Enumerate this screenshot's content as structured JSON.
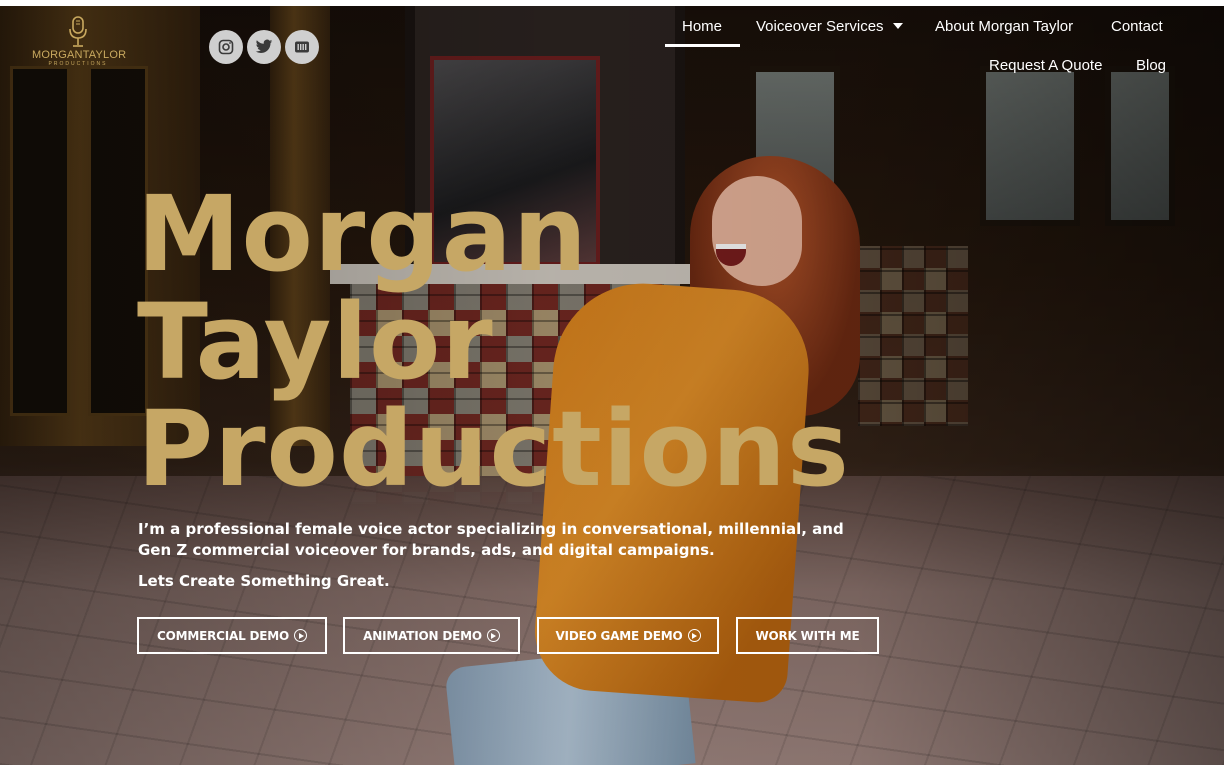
{
  "brand": {
    "logo_text": "MORGANTAYLOR",
    "logo_subtext": "PRODUCTIONS",
    "logo_icon": "microphone-icon",
    "accent_color": "#c6a765"
  },
  "social": [
    {
      "icon": "instagram-icon"
    },
    {
      "icon": "twitter-icon"
    },
    {
      "icon": "imdb-icon"
    }
  ],
  "nav": {
    "home": "Home",
    "voiceover_services": "Voiceover Services",
    "about": "About Morgan Taylor",
    "contact": "Contact",
    "request_quote": "Request A Quote",
    "blog": "Blog",
    "active": "Home"
  },
  "hero": {
    "title_line1": "Morgan",
    "title_line2": "Taylor",
    "title_line3": "Productions",
    "tagline": "I’m a professional female voice actor specializing in conversational, millennial, and Gen Z commercial voiceover for brands, ads, and digital campaigns.",
    "subline": "Lets Create Something Great."
  },
  "buttons": {
    "commercial": "COMMERCIAL DEMO",
    "animation": "ANIMATION DEMO",
    "video_game": "VIDEO GAME DEMO",
    "work": "WORK WITH ME"
  }
}
